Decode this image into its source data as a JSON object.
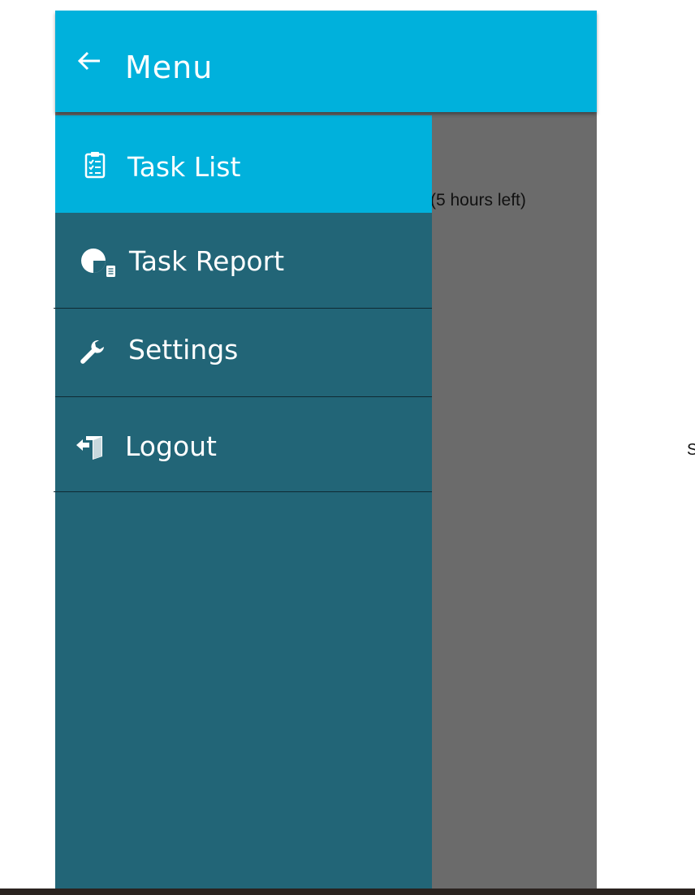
{
  "header": {
    "title": "Menu",
    "back_icon": "back-arrow-icon"
  },
  "drawer": {
    "items": [
      {
        "label": "Task List",
        "icon": "clipboard-checklist-icon",
        "active": true
      },
      {
        "label": "Task Report",
        "icon": "pie-report-icon",
        "active": false
      },
      {
        "label": "Settings",
        "icon": "wrench-icon",
        "active": false
      },
      {
        "label": "Logout",
        "icon": "logout-door-icon",
        "active": false
      }
    ]
  },
  "background_tasks": [
    {
      "text": "(5 hours left)"
    },
    {
      "text": ""
    },
    {
      "text": ""
    },
    {
      "text": ""
    },
    {
      "text": ""
    }
  ],
  "side_text": "S",
  "colors": {
    "header": "#00b1dc",
    "drawer": "#226577",
    "active_item": "#00b1dc",
    "overlay": "#6b6b6b",
    "bottom_bar": "#2a2320"
  }
}
